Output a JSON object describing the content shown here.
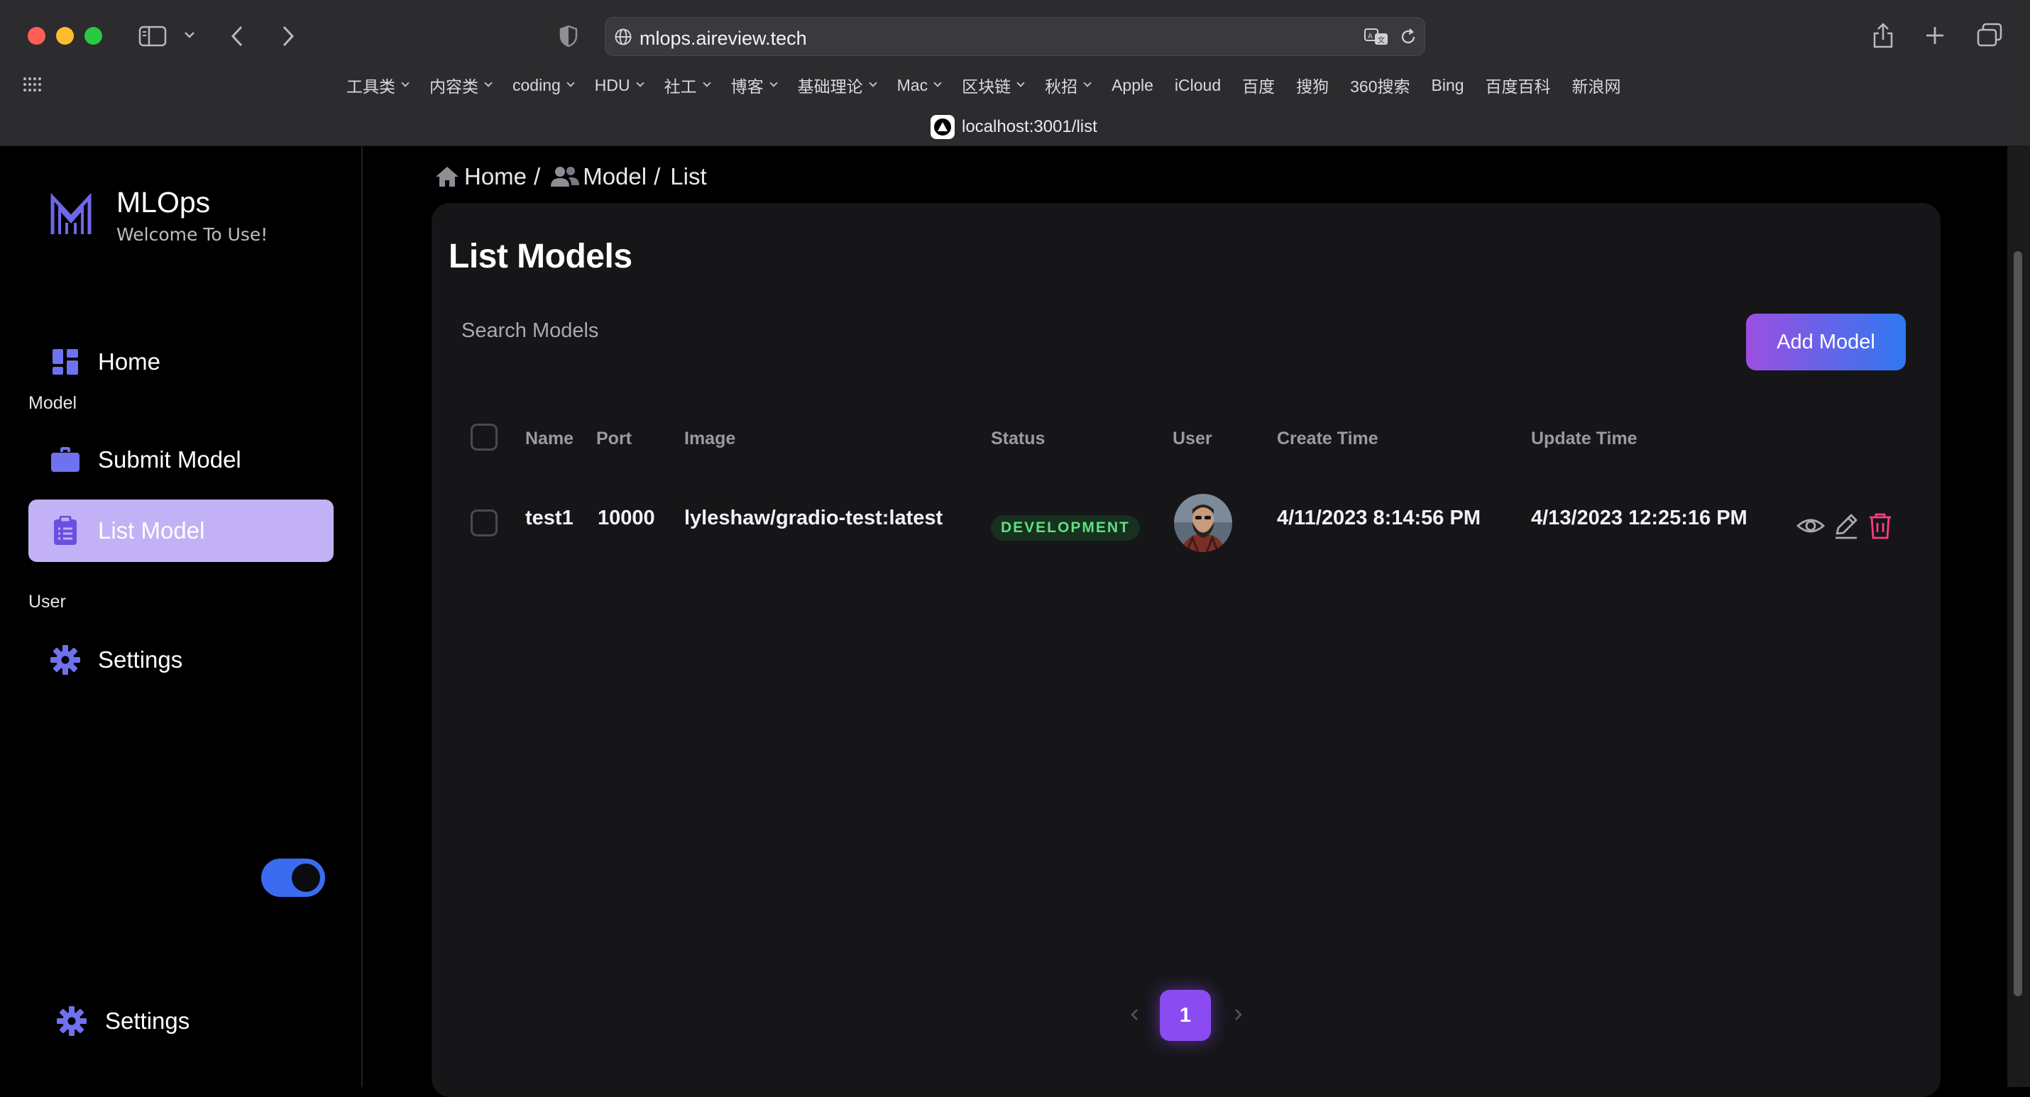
{
  "browser": {
    "url": "mlops.aireview.tech",
    "tab_title": "localhost:3001/list",
    "bookmarks": [
      {
        "label": "工具类",
        "dropdown": true
      },
      {
        "label": "内容类",
        "dropdown": true
      },
      {
        "label": "coding",
        "dropdown": true
      },
      {
        "label": "HDU",
        "dropdown": true
      },
      {
        "label": "社工",
        "dropdown": true
      },
      {
        "label": "博客",
        "dropdown": true
      },
      {
        "label": "基础理论",
        "dropdown": true
      },
      {
        "label": "Mac",
        "dropdown": true
      },
      {
        "label": "区块链",
        "dropdown": true
      },
      {
        "label": "秋招",
        "dropdown": true
      },
      {
        "label": "Apple",
        "dropdown": false
      },
      {
        "label": "iCloud",
        "dropdown": false
      },
      {
        "label": "百度",
        "dropdown": false
      },
      {
        "label": "搜狗",
        "dropdown": false
      },
      {
        "label": "360搜索",
        "dropdown": false
      },
      {
        "label": "Bing",
        "dropdown": false
      },
      {
        "label": "百度百科",
        "dropdown": false
      },
      {
        "label": "新浪网",
        "dropdown": false
      }
    ]
  },
  "sidebar": {
    "brand": {
      "name": "MLOps",
      "subtitle": "Welcome To Use!"
    },
    "home": {
      "label": "Home",
      "icon": "dashboard-icon"
    },
    "section_model": "Model",
    "submit_model": {
      "label": "Submit Model",
      "icon": "briefcase-icon"
    },
    "list_model": {
      "label": "List Model",
      "icon": "clipboard-icon",
      "active": true
    },
    "section_user": "User",
    "settings": {
      "label": "Settings",
      "icon": "gear-icon"
    },
    "footer": {
      "label": "Settings",
      "toggle_on": true
    }
  },
  "breadcrumb": {
    "home": "Home",
    "model": "Model",
    "list": "List",
    "sep": "/"
  },
  "main": {
    "title": "List Models",
    "search_placeholder": "Search Models",
    "add_button": "Add Model",
    "columns": {
      "name": "Name",
      "port": "Port",
      "image": "Image",
      "status": "Status",
      "user": "User",
      "create_time": "Create Time",
      "update_time": "Update Time"
    },
    "rows": [
      {
        "name": "test1",
        "port": "10000",
        "image": "lyleshaw/gradio-test:latest",
        "status": "DEVELOPMENT",
        "create_time": "4/11/2023 8:14:56 PM",
        "update_time": "4/13/2023 12:25:16 PM"
      }
    ],
    "pagination": {
      "current": "1"
    }
  },
  "colors": {
    "accent": "#8a4cf0",
    "active_nav": "#c3b1f5",
    "status_green": "#5ee07f",
    "delete_pink": "#ff3d7f",
    "toggle_blue": "#3b6cf0"
  }
}
